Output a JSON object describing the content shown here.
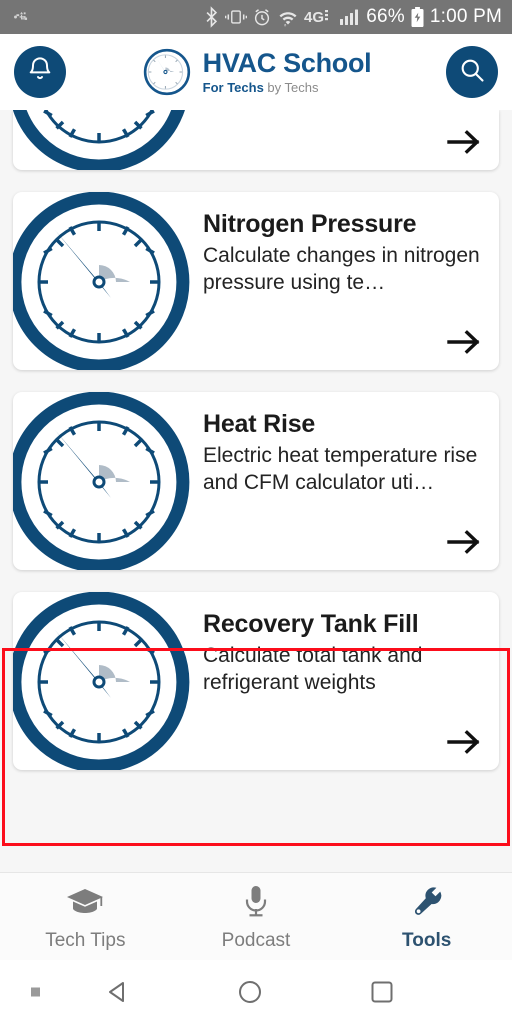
{
  "status_bar": {
    "usb_icon": "usb-icon",
    "bluetooth_icon": "bluetooth-icon",
    "vibrate_icon": "vibrate-icon",
    "alarm_icon": "alarm-icon",
    "wifi_icon": "wifi-icon",
    "network_type": "4G",
    "signal_icon": "signal-bars-icon",
    "battery_percent": "66%",
    "battery_icon": "battery-charging-icon",
    "time": "1:00 PM"
  },
  "header": {
    "notification_icon": "bell-icon",
    "search_icon": "search-icon",
    "logo_icon": "gauge-logo-icon",
    "brand_title": "HVAC School",
    "brand_sub_bold": "For Techs",
    "brand_sub_rest": " by Techs"
  },
  "colors": {
    "brand_blue": "#0e4a77",
    "brand_title_blue": "#15568c",
    "highlight_red": "#fc0d1b",
    "active_tab": "#2d5270",
    "status_bar_gray": "#757575",
    "page_bg": "#f6f6f6"
  },
  "cards": [
    {
      "title": "",
      "desc": "",
      "icon": "gauge-icon",
      "arrow_icon": "arrow-right-icon",
      "partial": true,
      "highlighted": false
    },
    {
      "title": "Nitrogen Pressure",
      "desc": "Calculate changes in nitrogen pressure using te…",
      "icon": "gauge-icon",
      "arrow_icon": "arrow-right-icon",
      "partial": false,
      "highlighted": false
    },
    {
      "title": "Heat Rise",
      "desc": "Electric heat temperature rise and CFM calculator uti…",
      "icon": "gauge-icon",
      "arrow_icon": "arrow-right-icon",
      "partial": false,
      "highlighted": false
    },
    {
      "title": "Recovery Tank Fill",
      "desc": "Calculate total tank and refrigerant weights",
      "icon": "gauge-icon",
      "arrow_icon": "arrow-right-icon",
      "partial": false,
      "highlighted": true
    }
  ],
  "tabs": [
    {
      "label": "Tech Tips",
      "icon": "graduation-cap-icon",
      "active": false
    },
    {
      "label": "Podcast",
      "icon": "microphone-icon",
      "active": false
    },
    {
      "label": "Tools",
      "icon": "wrench-icon",
      "active": true
    }
  ],
  "android_nav": {
    "dot_icon": "menu-dot-icon",
    "back_icon": "back-triangle-icon",
    "home_icon": "home-circle-icon",
    "recent_icon": "recent-square-icon"
  }
}
